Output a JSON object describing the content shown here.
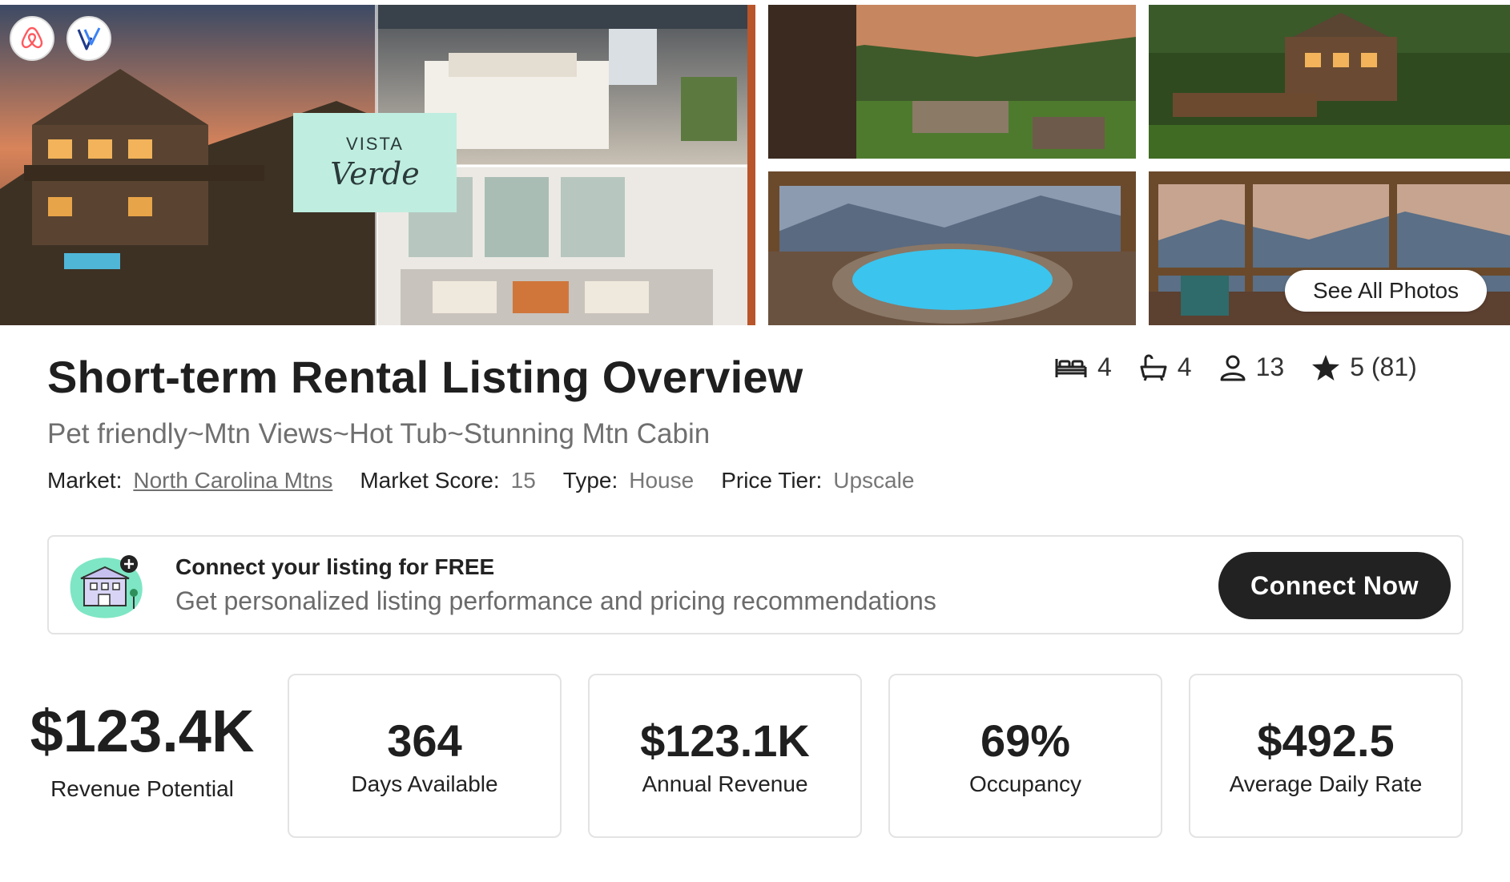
{
  "gallery": {
    "badges": [
      "airbnb-logo",
      "vrbo-logo"
    ],
    "brand_top": "VISTA",
    "brand_script": "Verde",
    "see_all_label": "See All Photos"
  },
  "listing": {
    "title": "Short-term Rental Listing Overview",
    "subtitle": "Pet friendly~Mtn Views~Hot Tub~Stunning Mtn Cabin",
    "meta": {
      "market_label": "Market:",
      "market_value": "North Carolina Mtns",
      "score_label": "Market Score:",
      "score_value": "15",
      "type_label": "Type:",
      "type_value": "House",
      "tier_label": "Price Tier:",
      "tier_value": "Upscale"
    },
    "stats": {
      "bedrooms": "4",
      "bathrooms": "4",
      "guests": "13",
      "rating": "5 (81)"
    }
  },
  "connect": {
    "title": "Connect your listing for FREE",
    "description": "Get personalized listing performance and pricing recommendations",
    "button_label": "Connect Now"
  },
  "metrics": {
    "revenue_potential": {
      "value": "$123.4K",
      "label": "Revenue Potential"
    },
    "cards": [
      {
        "value": "364",
        "label": "Days Available"
      },
      {
        "value": "$123.1K",
        "label": "Annual Revenue"
      },
      {
        "value": "69%",
        "label": "Occupancy"
      },
      {
        "value": "$492.5",
        "label": "Average Daily Rate"
      }
    ]
  },
  "colors": {
    "primary_button": "#222222",
    "brand_card": "#bfeee0",
    "accent_orange": "#b8552a"
  }
}
